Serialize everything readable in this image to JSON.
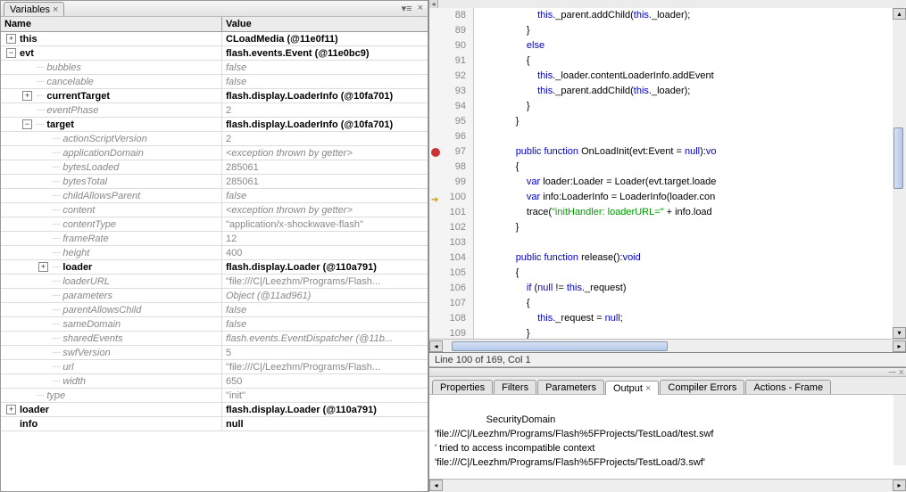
{
  "variables_panel": {
    "tab_label": "Variables",
    "header_name": "Name",
    "header_value": "Value",
    "rows": [
      {
        "indent": 0,
        "exp": "plus",
        "dot": false,
        "name": "this",
        "bold": true,
        "value": "CLoadMedia (@11e0f11)",
        "vclass": "bold"
      },
      {
        "indent": 0,
        "exp": "minus",
        "dot": false,
        "name": "evt",
        "bold": true,
        "value": "flash.events.Event (@11e0bc9)",
        "vclass": "bold"
      },
      {
        "indent": 1,
        "exp": "",
        "dot": true,
        "name": "bubbles",
        "dim": true,
        "value": "false",
        "vclass": "dim"
      },
      {
        "indent": 1,
        "exp": "",
        "dot": true,
        "name": "cancelable",
        "dim": true,
        "value": "false",
        "vclass": "dim"
      },
      {
        "indent": 1,
        "exp": "plus",
        "dot": true,
        "name": "currentTarget",
        "bold": true,
        "value": "flash.display.LoaderInfo (@10fa701)",
        "vclass": "bold"
      },
      {
        "indent": 1,
        "exp": "",
        "dot": true,
        "name": "eventPhase",
        "dim": true,
        "value": "2",
        "vclass": "num"
      },
      {
        "indent": 1,
        "exp": "minus",
        "dot": true,
        "name": "target",
        "bold": true,
        "value": "flash.display.LoaderInfo (@10fa701)",
        "vclass": "bold"
      },
      {
        "indent": 2,
        "exp": "",
        "dot": true,
        "name": "actionScriptVersion",
        "dim": true,
        "value": "2",
        "vclass": "num"
      },
      {
        "indent": 2,
        "exp": "",
        "dot": true,
        "name": "applicationDomain",
        "dim": true,
        "value": "<exception thrown by getter>",
        "vclass": "dim"
      },
      {
        "indent": 2,
        "exp": "",
        "dot": true,
        "name": "bytesLoaded",
        "dim": true,
        "value": "285061",
        "vclass": "num"
      },
      {
        "indent": 2,
        "exp": "",
        "dot": true,
        "name": "bytesTotal",
        "dim": true,
        "value": "285061",
        "vclass": "num"
      },
      {
        "indent": 2,
        "exp": "",
        "dot": true,
        "name": "childAllowsParent",
        "dim": true,
        "value": "false",
        "vclass": "dim"
      },
      {
        "indent": 2,
        "exp": "",
        "dot": true,
        "name": "content",
        "dim": true,
        "value": "<exception thrown by getter>",
        "vclass": "dim"
      },
      {
        "indent": 2,
        "exp": "",
        "dot": true,
        "name": "contentType",
        "dim": true,
        "value": "\"application/x-shockwave-flash\"",
        "vclass": "qstr"
      },
      {
        "indent": 2,
        "exp": "",
        "dot": true,
        "name": "frameRate",
        "dim": true,
        "value": "12",
        "vclass": "num"
      },
      {
        "indent": 2,
        "exp": "",
        "dot": true,
        "name": "height",
        "dim": true,
        "value": "400",
        "vclass": "num"
      },
      {
        "indent": 2,
        "exp": "plus",
        "dot": true,
        "name": "loader",
        "bold": true,
        "value": "flash.display.Loader (@110a791)",
        "vclass": "bold"
      },
      {
        "indent": 2,
        "exp": "",
        "dot": true,
        "name": "loaderURL",
        "dim": true,
        "value": "\"file:///C|/Leezhm/Programs/Flash...",
        "vclass": "qstr"
      },
      {
        "indent": 2,
        "exp": "",
        "dot": true,
        "name": "parameters",
        "dim": true,
        "value": "Object (@11ad961)",
        "vclass": "dim"
      },
      {
        "indent": 2,
        "exp": "",
        "dot": true,
        "name": "parentAllowsChild",
        "dim": true,
        "value": "false",
        "vclass": "dim"
      },
      {
        "indent": 2,
        "exp": "",
        "dot": true,
        "name": "sameDomain",
        "dim": true,
        "value": "false",
        "vclass": "dim"
      },
      {
        "indent": 2,
        "exp": "",
        "dot": true,
        "name": "sharedEvents",
        "dim": true,
        "value": "flash.events.EventDispatcher (@11b...",
        "vclass": "dim"
      },
      {
        "indent": 2,
        "exp": "",
        "dot": true,
        "name": "swfVersion",
        "dim": true,
        "value": "5",
        "vclass": "num"
      },
      {
        "indent": 2,
        "exp": "",
        "dot": true,
        "name": "url",
        "dim": true,
        "value": "\"file:///C|/Leezhm/Programs/Flash...",
        "vclass": "qstr"
      },
      {
        "indent": 2,
        "exp": "",
        "dot": true,
        "name": "width",
        "dim": true,
        "value": "650",
        "vclass": "num"
      },
      {
        "indent": 1,
        "exp": "",
        "dot": true,
        "name": "type",
        "dim": true,
        "value": "\"init\"",
        "vclass": "qstr"
      },
      {
        "indent": 0,
        "exp": "plus",
        "dot": false,
        "name": "loader",
        "bold": true,
        "value": "flash.display.Loader (@110a791)",
        "vclass": "bold"
      },
      {
        "indent": 0,
        "exp": "",
        "dot": false,
        "name": "info",
        "bold": true,
        "value": "null",
        "vclass": "bold"
      }
    ]
  },
  "code": {
    "lines": [
      {
        "n": 88,
        "html": "                    <span class='kw'>this</span>._parent.addChild(<span class='kw'>this</span>._loader);"
      },
      {
        "n": 89,
        "html": "                }"
      },
      {
        "n": 90,
        "html": "                <span class='kw'>else</span>"
      },
      {
        "n": 91,
        "html": "                {"
      },
      {
        "n": 92,
        "html": "                    <span class='kw'>this</span>._loader.contentLoaderInfo.addEvent"
      },
      {
        "n": 93,
        "html": "                    <span class='kw'>this</span>._parent.addChild(<span class='kw'>this</span>._loader);"
      },
      {
        "n": 94,
        "html": "                }"
      },
      {
        "n": 95,
        "html": "            }"
      },
      {
        "n": 96,
        "html": ""
      },
      {
        "n": 97,
        "marker": "bp",
        "html": "            <span class='kw'>public</span> <span class='kw'>function</span> <span class='fn'>OnLoadInit</span>(evt:Event = <span class='kw'>null</span>):<span class='kw'>vo</span>"
      },
      {
        "n": 98,
        "html": "            {"
      },
      {
        "n": 99,
        "html": "                <span class='kw'>var</span> loader:Loader = Loader(evt.target.loade"
      },
      {
        "n": 100,
        "marker": "arrow",
        "html": "                <span class='kw'>var</span> info:LoaderInfo = LoaderInfo(loader.con"
      },
      {
        "n": 101,
        "html": "                trace(<span class='str'>\"initHandler: loaderURL=\"</span> + info.load"
      },
      {
        "n": 102,
        "html": "            }"
      },
      {
        "n": 103,
        "html": ""
      },
      {
        "n": 104,
        "html": "            <span class='kw'>public</span> <span class='kw'>function</span> <span class='fn'>release</span>():<span class='kw'>void</span>"
      },
      {
        "n": 105,
        "html": "            {"
      },
      {
        "n": 106,
        "html": "                <span class='kw'>if</span> (<span class='kw'>null</span> != <span class='kw'>this</span>._request)"
      },
      {
        "n": 107,
        "html": "                {"
      },
      {
        "n": 108,
        "html": "                    <span class='kw'>this</span>._request = <span class='kw'>null</span>;"
      },
      {
        "n": 109,
        "html": "                }"
      }
    ],
    "status": "Line 100 of 169, Col 1"
  },
  "bottom_tabs": {
    "items": [
      {
        "label": "Properties",
        "active": false
      },
      {
        "label": "Filters",
        "active": false
      },
      {
        "label": "Parameters",
        "active": false
      },
      {
        "label": "Output",
        "active": true,
        "close": true
      },
      {
        "label": "Compiler Errors",
        "active": false
      },
      {
        "label": "Actions - Frame",
        "active": false
      }
    ]
  },
  "output_text": "SecurityDomain\n'file:///C|/Leezhm/Programs/Flash%5FProjects/TestLoad/test.swf\n' tried to access incompatible context\n'file:///C|/Leezhm/Programs/Flash%5FProjects/TestLoad/3.swf'"
}
